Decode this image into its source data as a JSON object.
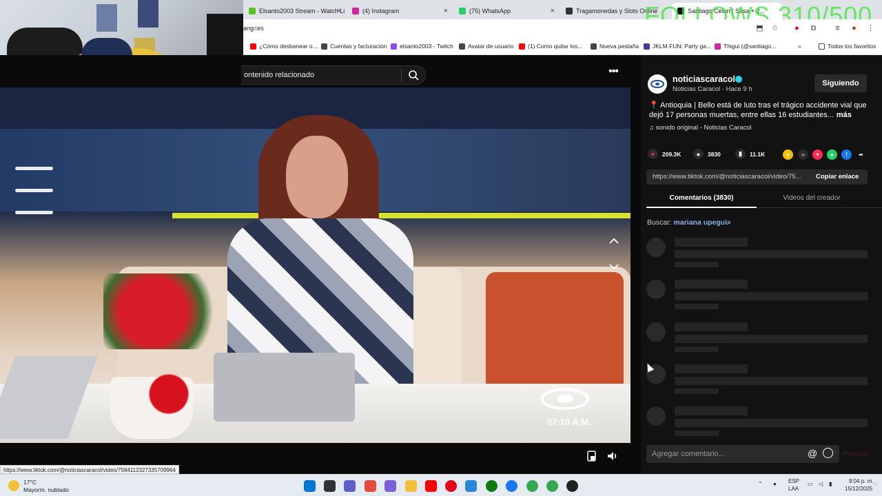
{
  "browser": {
    "tabs": [
      {
        "title": "Elsanto2003 Stream - Watch Li",
        "color": "#58c323"
      },
      {
        "title": "(4) Instagram",
        "color": "#d6249f"
      },
      {
        "title": "(75) WhatsApp",
        "color": "#25d366"
      },
      {
        "title": "Tragamonedas y Slots Online",
        "color": "#333333"
      },
      {
        "title": "Santiago Celon | Sasa + 2...",
        "color": "#111111"
      }
    ],
    "url_fragment": "ang=es",
    "bookmarks": [
      {
        "label": "¿Cómo desbanear o...",
        "color": "#ff0000"
      },
      {
        "label": "Cuentas y facturación",
        "color": "#444444"
      },
      {
        "label": "elsanto2003 - Twitch",
        "color": "#9146ff"
      },
      {
        "label": "Avatar de usuario",
        "color": "#444444"
      },
      {
        "label": "(1) Como quitar los...",
        "color": "#ff0000"
      },
      {
        "label": "Nueva pestaña",
        "color": "#444444"
      },
      {
        "label": "JKLM.FUN: Party ga...",
        "color": "#3a3aa0"
      },
      {
        "label": "Thigui (@santiago...",
        "color": "#d6249f"
      }
    ],
    "bookmarks_more": "»",
    "all_favorites": "Todos los favoritos"
  },
  "overlay": {
    "follows_goal": "FOLLOWS 310/500"
  },
  "video": {
    "related_search": "ontenido relacionado",
    "timestamp": "07:10 A.M.",
    "more_menu": "•••",
    "status_url": "https://www.tiktok.com/@noticiascaracol/video/7584112327335709964"
  },
  "post": {
    "username": "noticiascaracol",
    "subline": "Noticias Caracol · Hace 9 h",
    "follow_label": "Siguiendo",
    "caption": "📍 Antioquia | Bello está de luto tras el trágico accidente vial que dejó 17 personas muertas, entre ellas 16 estudiantes...",
    "more": "más",
    "sound": "♫  sonido original - Noticias Caracol",
    "likes": "209.3K",
    "comments": "3830",
    "saves": "11.1K",
    "link": "https://www.tiktok.com/@noticiascaracol/video/75...",
    "copy_label": "Copiar enlace",
    "tab_comments": "Comentarios (3830)",
    "tab_creator": "Videos del creador",
    "search_prefix": "Buscar:",
    "search_query": "mariana upegui",
    "comment_placeholder": "Agregar comentario...",
    "comment_at": "@",
    "publish_label": "Publicar"
  },
  "taskbar": {
    "temp": "17°C",
    "weather": "Mayorm. nublado",
    "lang_top": "ESP",
    "lang_bottom": "LAA",
    "time": "9:04 p. m.",
    "date": "15/12/2025",
    "app_colors": [
      "#0078d4",
      "#333333",
      "#5b5fc7",
      "#e34b3c",
      "#7b5fd6",
      "#f2c037",
      "#ff0000",
      "#e3001b",
      "#2b88d8",
      "#0f7b0f",
      "#1877f2",
      "#34a853",
      "#34a853",
      "#222222"
    ]
  }
}
